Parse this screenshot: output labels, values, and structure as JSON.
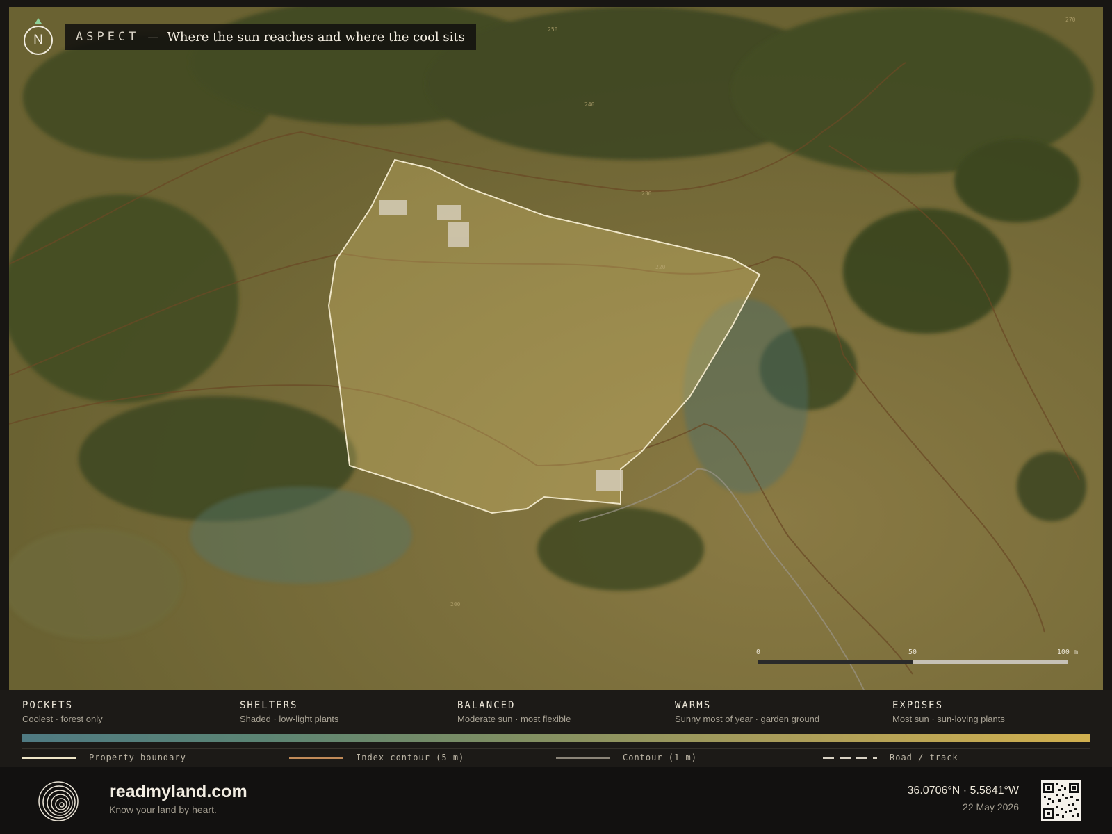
{
  "map": {
    "title_label": "ASPECT",
    "title_dash": "—",
    "title_text": "Where the sun reaches and where the cool sits",
    "north_label": "N",
    "contour_labels": [
      "250",
      "270",
      "240",
      "230",
      "220",
      "200"
    ],
    "scale": {
      "start": "0",
      "mid": "50",
      "end": "100 m"
    }
  },
  "legend": {
    "categories": [
      {
        "name": "POCKETS",
        "desc": "Coolest · forest only"
      },
      {
        "name": "SHELTERS",
        "desc": "Shaded · low-light plants"
      },
      {
        "name": "BALANCED",
        "desc": "Moderate sun · most flexible"
      },
      {
        "name": "WARMS",
        "desc": "Sunny most of year · garden ground"
      },
      {
        "name": "EXPOSES",
        "desc": "Most sun · sun-loving plants"
      }
    ],
    "keys": [
      {
        "label": "Property boundary",
        "color": "#efe6c8"
      },
      {
        "label": "Index contour (5 m)",
        "color": "#c08a58"
      },
      {
        "label": "Contour (1 m)",
        "color": "#8a8478"
      },
      {
        "label": "Road / track",
        "color": "#d8d2c4"
      }
    ]
  },
  "footer": {
    "brand": "readmyland.com",
    "tagline": "Know your land by heart.",
    "coords": "36.0706°N · 5.5841°W",
    "date": "22 May 2026"
  }
}
